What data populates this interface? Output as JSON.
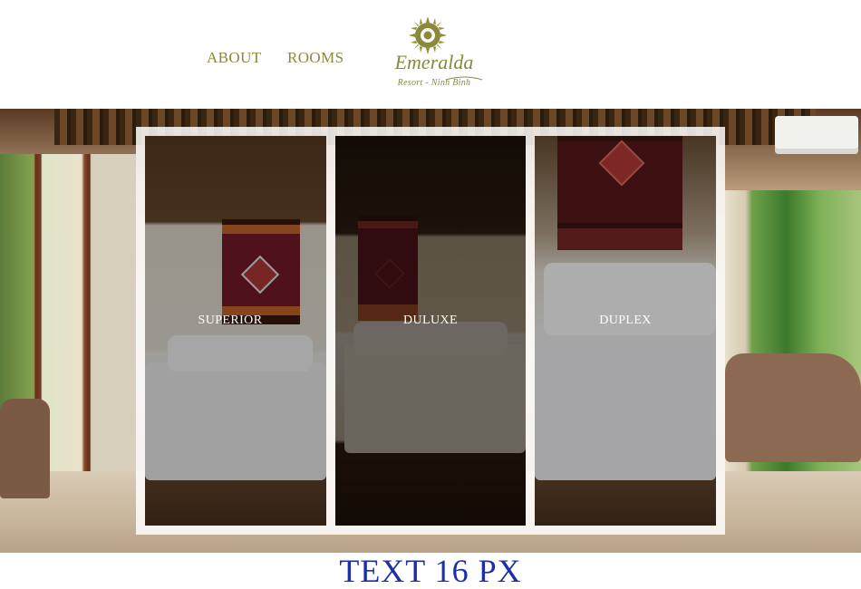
{
  "header": {
    "nav": [
      {
        "label": "ABOUT"
      },
      {
        "label": "ROOMS"
      }
    ],
    "logo": {
      "name": "Emeralda",
      "tagline": "Resort - Ninh Binh",
      "icon": "sun-logo-icon"
    }
  },
  "rooms": [
    {
      "label": "SUPERIOR"
    },
    {
      "label": "DULUXE"
    },
    {
      "label": "DUPLEX"
    }
  ],
  "footer": {
    "text": "TEXT 16 PX"
  },
  "colors": {
    "brand": "#8a8a3a",
    "footer_text": "#1a2fa8",
    "card_label": "#ffffff"
  }
}
